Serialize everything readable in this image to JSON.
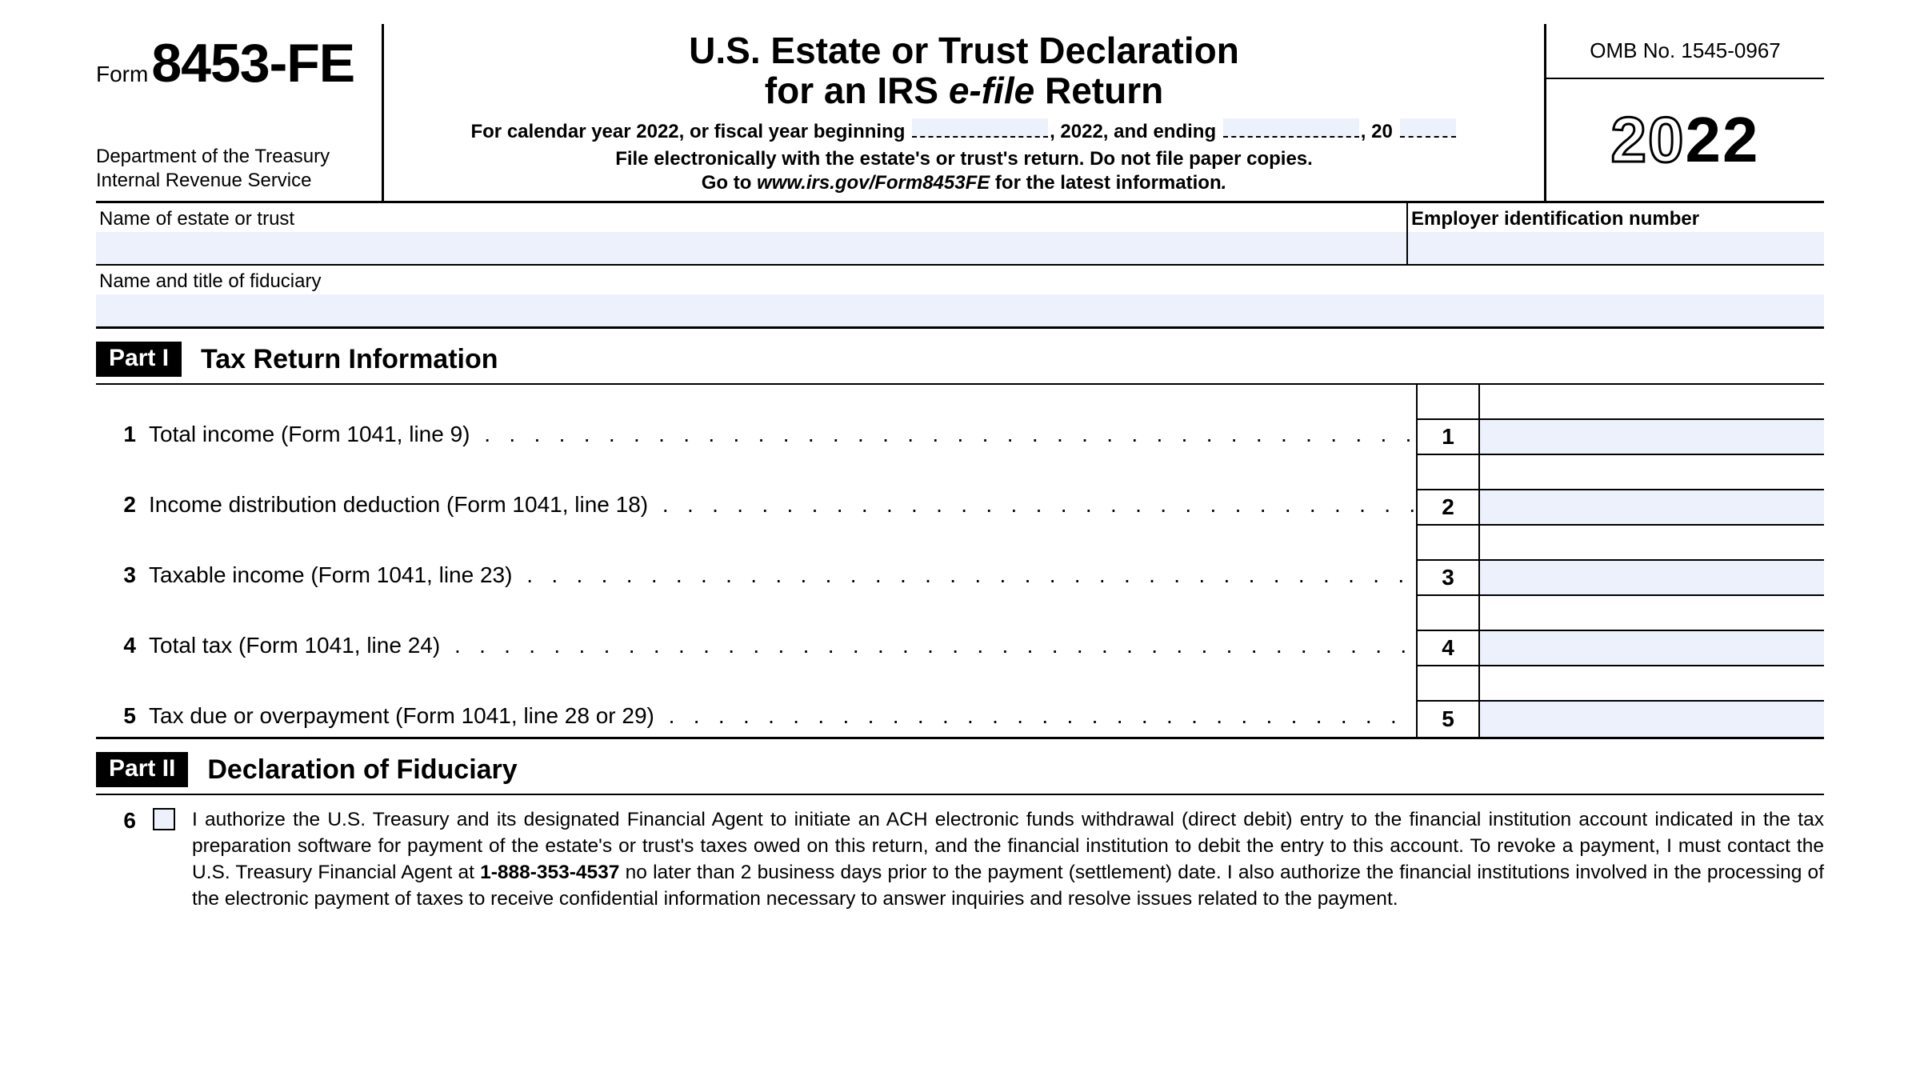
{
  "header": {
    "form_word": "Form",
    "form_number": "8453-FE",
    "dept_line1": "Department of the Treasury",
    "dept_line2": "Internal Revenue Service",
    "title_line1": "U.S. Estate or Trust Declaration",
    "title_line2_a": "for an IRS ",
    "title_line2_efile": "e-file",
    "title_line2_b": " Return",
    "fy_a": "For calendar year 2022, or fiscal year beginning",
    "fy_b": ", 2022, and ending",
    "fy_c": ", 20",
    "instr1": "File electronically with the estate's or trust's return. Do not file paper copies.",
    "instr2a": "Go to ",
    "instr2_url": "www.irs.gov/Form8453FE",
    "instr2b": " for the latest information",
    "omb": "OMB No. 1545-0967",
    "year_outline": "20",
    "year_solid": "22"
  },
  "id": {
    "name_label": "Name of estate or trust",
    "ein_label": "Employer identification number",
    "fiduciary_label": "Name and title of fiduciary"
  },
  "part1": {
    "badge": "Part I",
    "title": "Tax Return Information",
    "rows": [
      {
        "n": "1",
        "desc": "Total income (Form 1041, line 9)"
      },
      {
        "n": "2",
        "desc": "Income distribution deduction (Form 1041, line 18)"
      },
      {
        "n": "3",
        "desc": "Taxable income (Form 1041, line 23)"
      },
      {
        "n": "4",
        "desc": "Total tax (Form 1041, line 24)"
      },
      {
        "n": "5",
        "desc": "Tax due or overpayment (Form 1041, line 28 or 29)"
      }
    ]
  },
  "part2": {
    "badge": "Part II",
    "title": "Declaration of Fiduciary",
    "num": "6",
    "text_a": "I authorize the U.S. Treasury and its designated Financial Agent to initiate an ACH electronic funds withdrawal (direct debit) entry to the financial institution account indicated in the tax preparation software for payment of the estate's or trust's taxes owed on this return, and the financial institution to debit the entry to this account. To revoke a payment, I must contact the U.S. Treasury Financial Agent at ",
    "phone": "1-888-353-4537",
    "text_b": " no later than 2 business days prior to the payment (settlement) date. I also authorize the financial institutions involved in the processing of the electronic payment of taxes to receive confidential information necessary to answer inquiries and resolve issues related to the payment."
  }
}
